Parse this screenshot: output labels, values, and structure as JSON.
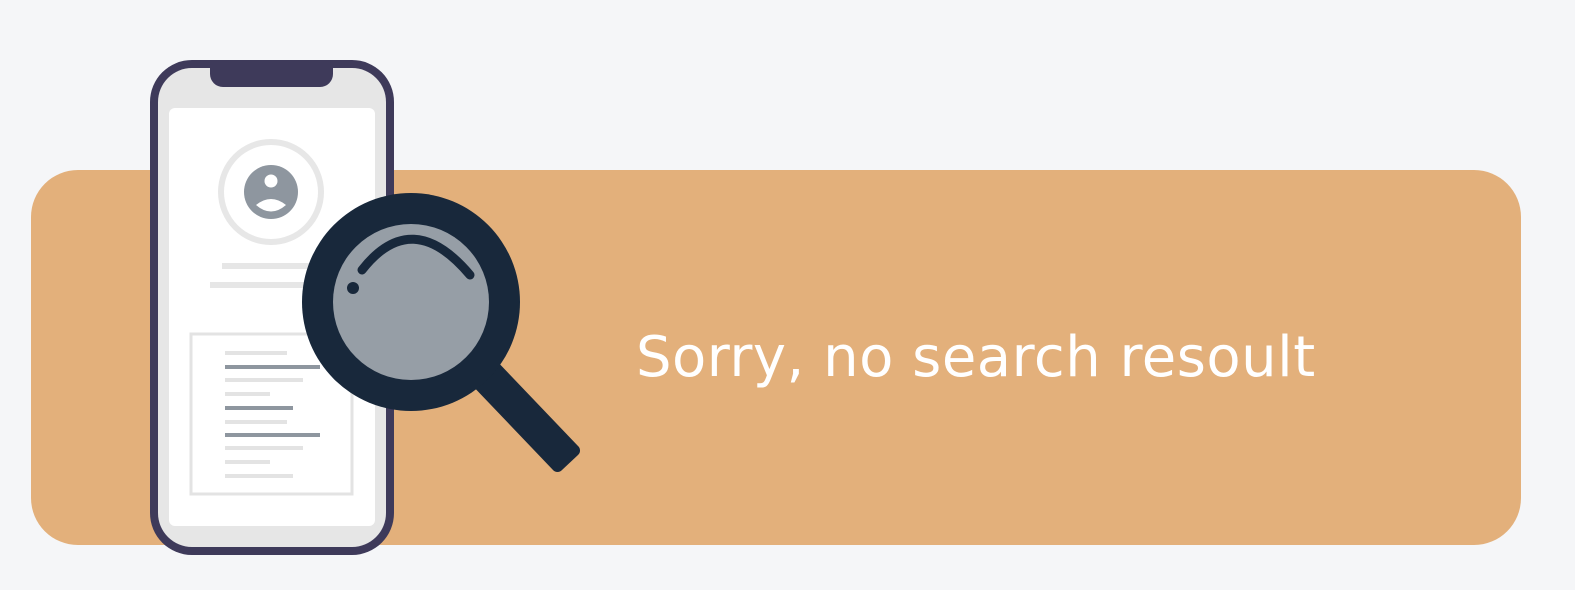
{
  "empty_state": {
    "message": "Sorry, no search resoult",
    "illustration": {
      "phone_icon": "smartphone-icon",
      "avatar_icon": "user-avatar-icon",
      "search_icon": "magnifying-glass-icon"
    }
  },
  "colors": {
    "page_background": "#f5f6f8",
    "banner": "#e3b07b",
    "message_text": "#ffffff",
    "phone_frame": "#3e3a5a",
    "phone_body": "#e6e6e6",
    "screen": "#ffffff",
    "avatar": "#8e969f",
    "magnifier": "#18283b"
  }
}
